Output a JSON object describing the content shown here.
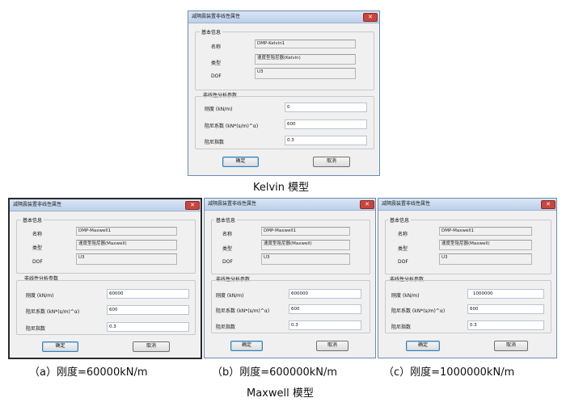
{
  "dialogs": [
    {
      "title": "减隔震装置非线性属性",
      "basic_group": "基本信息",
      "name_label": "名称",
      "name_value": "DMP-Kelvin1",
      "type_label": "类型",
      "type_value": "速度型阻尼器(Kelvin)",
      "dof_label": "DOF",
      "dof_value": "U3",
      "nonlinear_group": "非线性分析参数",
      "stiffness_label": "刚度 (kN/m)",
      "stiffness_value": "0",
      "damping_label": "阻尼系数 (kN*(s/m)^α)",
      "damping_value": "600",
      "exponent_label": "阻尼指数",
      "exponent_value": "0.3",
      "ok": "确定",
      "cancel": "取消"
    },
    {
      "title": "减隔震装置非线性属性",
      "basic_group": "基本信息",
      "name_label": "名称",
      "name_value": "DMP-Maxwell1",
      "type_label": "类型",
      "type_value": "速度型阻尼器(Maxwell)",
      "dof_label": "DOF",
      "dof_value": "U3",
      "nonlinear_group": "非线性分析参数",
      "stiffness_label": "刚度 (kN/m)",
      "stiffness_value": "60000",
      "damping_label": "阻尼系数 (kN*(s/m)^α)",
      "damping_value": "600",
      "exponent_label": "阻尼指数",
      "exponent_value": "0.3",
      "ok": "确定",
      "cancel": "取消"
    },
    {
      "title": "减隔震装置非线性属性",
      "basic_group": "基本信息",
      "name_label": "名称",
      "name_value": "DMP-Maxwell1",
      "type_label": "类型",
      "type_value": "速度型阻尼器(Maxwell)",
      "dof_label": "DOF",
      "dof_value": "U3",
      "nonlinear_group": "非线性分析参数",
      "stiffness_label": "刚度 (kN/m)",
      "stiffness_value": "600000",
      "damping_label": "阻尼系数 (kN*(s/m)^α)",
      "damping_value": "600",
      "exponent_label": "阻尼指数",
      "exponent_value": "0.3",
      "ok": "确定",
      "cancel": "取消"
    },
    {
      "title": "减隔震装置非线性属性",
      "basic_group": "基本信息",
      "name_label": "名称",
      "name_value": "DMP-Maxwell1",
      "type_label": "类型",
      "type_value": "速度型阻尼器(Maxwell)",
      "dof_label": "DOF",
      "dof_value": "U3",
      "nonlinear_group": "非线性分析参数",
      "stiffness_label": "刚度 (kN/m)",
      "stiffness_value": "1000000",
      "damping_label": "阻尼系数 (kN*(s/m)^α)",
      "damping_value": "600",
      "exponent_label": "阻尼指数",
      "exponent_value": "0.3",
      "ok": "确定",
      "cancel": "取消"
    }
  ],
  "captions": {
    "kelvin": "Kelvin 模型",
    "a": "（a）刚度=60000kN/m",
    "b": "（b）刚度=600000kN/m",
    "c": "（c）刚度=1000000kN/m",
    "maxwell": "Maxwell 模型"
  },
  "colors": {
    "titlebar": "#bcd0ea",
    "close_button": "#c9463d",
    "dialog_bg": "#f0f0f0"
  }
}
